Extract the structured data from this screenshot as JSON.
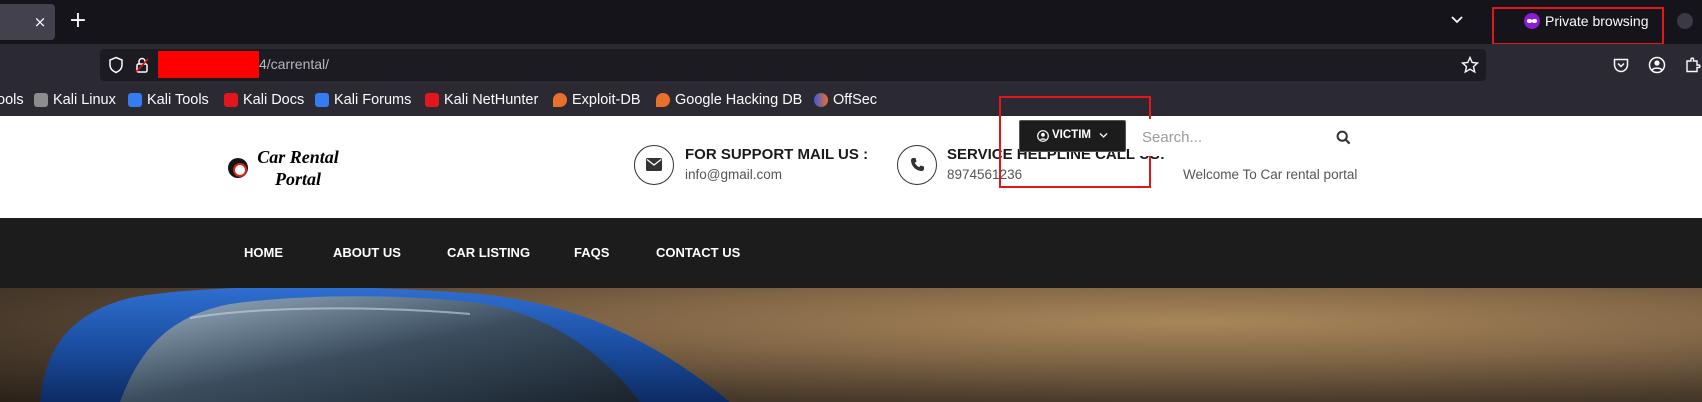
{
  "browser": {
    "tab_close": "×",
    "new_tab": "+",
    "private_label": "Private browsing",
    "url_text": "4/carrental/"
  },
  "bookmarks": [
    {
      "label": "ools",
      "icon": "kali-tools-icon",
      "color": "#367bf0"
    },
    {
      "label": "Kali Linux",
      "icon": "kali-dragon-icon",
      "color": "#aaaaaa"
    },
    {
      "label": "Kali Tools",
      "icon": "kali-tools-icon",
      "color": "#367bf0"
    },
    {
      "label": "Kali Docs",
      "icon": "kali-docs-icon",
      "color": "#e3161b"
    },
    {
      "label": "Kali Forums",
      "icon": "kali-forums-icon",
      "color": "#367bf0"
    },
    {
      "label": "Kali NetHunter",
      "icon": "nethunter-icon",
      "color": "#e3161b"
    },
    {
      "label": "Exploit-DB",
      "icon": "exploit-db-icon",
      "color": "#e8702a"
    },
    {
      "label": "Google Hacking DB",
      "icon": "ghdb-icon",
      "color": "#e8702a"
    },
    {
      "label": "OffSec",
      "icon": "offsec-icon",
      "color": "#3b5bdb"
    }
  ],
  "site": {
    "logo_line1": "Car Rental",
    "logo_line2": "Portal",
    "support_title": "FOR SUPPORT MAIL US :",
    "support_value": "info@gmail.com",
    "helpline_title": "SERVICE HELPLINE CALL US:",
    "helpline_value": "8974561236",
    "welcome": "Welcome To Car rental portal",
    "nav": [
      "HOME",
      "ABOUT US",
      "CAR LISTING",
      "FAQS",
      "CONTACT US"
    ],
    "user_label": "VICTIM",
    "search_placeholder": "Search..."
  },
  "colors": {
    "annotation_red": "#e3161b",
    "redaction_red": "#fe0000",
    "navbar_bg": "#1c1c1c",
    "private_purple": "#8b1bd8"
  }
}
